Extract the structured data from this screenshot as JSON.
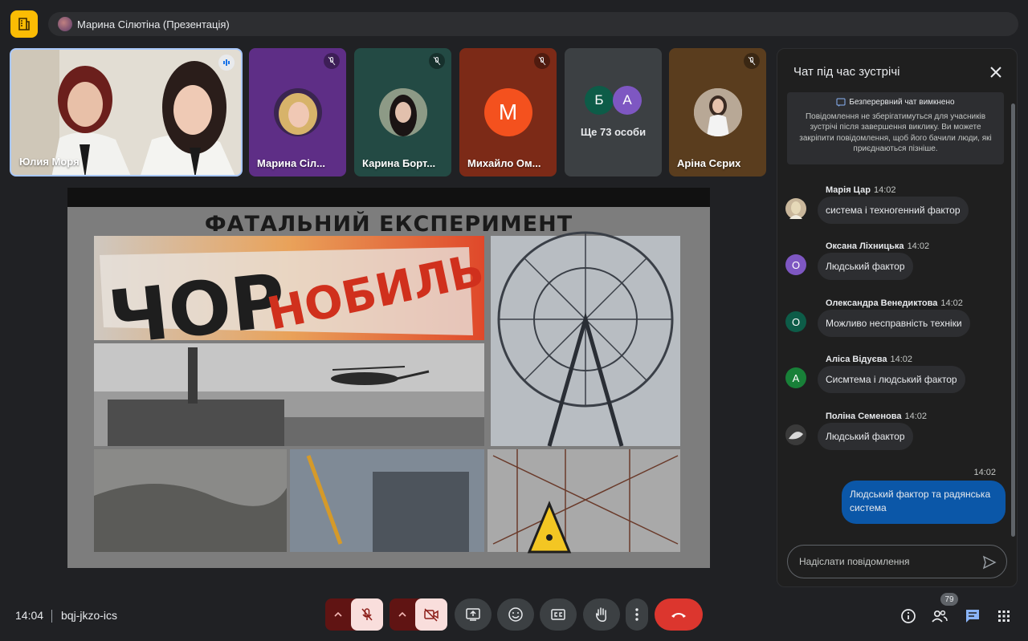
{
  "header": {
    "presenter_label": "Марина Сілютіна (Презентація)"
  },
  "tiles": [
    {
      "name": "Юлия Моря"
    },
    {
      "name": "Марина Сіл..."
    },
    {
      "name": "Карина Борт..."
    },
    {
      "name": "Михайло Ом...",
      "initial": "М"
    },
    {
      "more_label": "Ще 73 особи",
      "initials": [
        "Б",
        "А"
      ]
    },
    {
      "name": "Аріна Сєрих"
    }
  ],
  "slide": {
    "title": "ФАТАЛЬНИЙ ЕКСПЕРИМЕНТ",
    "banner_dark": "ЧОР",
    "banner_red": "НОБИЛЬ"
  },
  "chat": {
    "title": "Чат під час зустрічі",
    "notice_title": "Безперервний чат вимкнено",
    "notice_text": "Повідомлення не зберігатимуться для учасників зустрічі після завершення виклику. Ви можете закріпити повідомлення, щоб його бачили люди, які приєднаються пізніше.",
    "messages": [
      {
        "sender": "Марія Цар",
        "time": "14:02",
        "text": "система і техногенний фактор",
        "initial": ""
      },
      {
        "sender": "Оксана Ліхницька",
        "time": "14:02",
        "text": "Людський фактор",
        "initial": "О"
      },
      {
        "sender": "Олександра Венедиктова",
        "time": "14:02",
        "text": "Можливо несправність техніки",
        "initial": "О"
      },
      {
        "sender": "Аліса Відуєва",
        "time": "14:02",
        "text": "Сисмтема і людський фактор",
        "initial": "А"
      },
      {
        "sender": "Поліна Семенова",
        "time": "14:02",
        "text": "Людський фактор",
        "initial": ""
      }
    ],
    "my_message": {
      "time": "14:02",
      "text": "Людський фактор та радянська система"
    },
    "input_placeholder": "Надіслати повідомлення"
  },
  "footer": {
    "time": "14:04",
    "meeting_code": "bqj-jkzo-ics",
    "participants_count": "79"
  },
  "colors": {
    "background": "#202124",
    "accent_blue": "#8ab4f8",
    "end_call": "#dc362e",
    "my_bubble": "#0b57a8",
    "avatar_purple": "#7e57c2",
    "avatar_green": "#0d5c48",
    "avatar_orange": "#f4511e"
  }
}
